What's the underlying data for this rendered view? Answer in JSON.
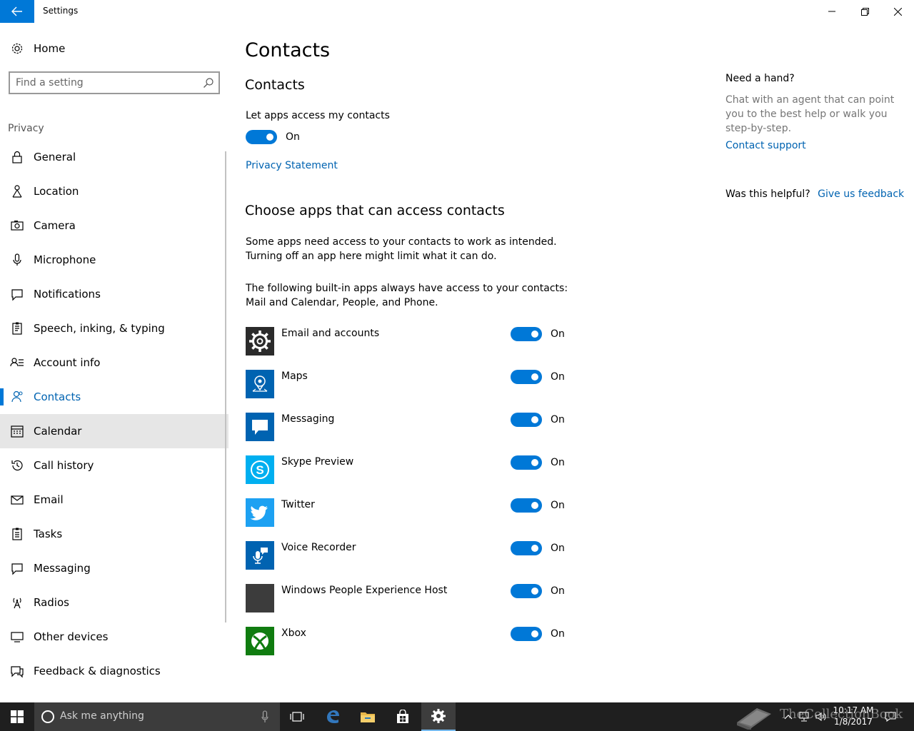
{
  "window": {
    "title": "Settings",
    "back_icon": "arrow-left-icon",
    "minimize_icon": "minimize-icon",
    "maximize_icon": "restore-icon",
    "close_icon": "close-icon"
  },
  "sidebar": {
    "home_label": "Home",
    "search_placeholder": "Find a setting",
    "group_label": "Privacy",
    "items": [
      {
        "label": "General",
        "icon": "lock-icon"
      },
      {
        "label": "Location",
        "icon": "location-icon"
      },
      {
        "label": "Camera",
        "icon": "camera-icon"
      },
      {
        "label": "Microphone",
        "icon": "microphone-icon"
      },
      {
        "label": "Notifications",
        "icon": "notifications-icon"
      },
      {
        "label": "Speech, inking, & typing",
        "icon": "speech-icon"
      },
      {
        "label": "Account info",
        "icon": "account-info-icon"
      },
      {
        "label": "Contacts",
        "icon": "contacts-icon",
        "active": true
      },
      {
        "label": "Calendar",
        "icon": "calendar-icon",
        "hover": true
      },
      {
        "label": "Call history",
        "icon": "history-icon"
      },
      {
        "label": "Email",
        "icon": "email-icon"
      },
      {
        "label": "Tasks",
        "icon": "tasks-icon"
      },
      {
        "label": "Messaging",
        "icon": "messaging-icon"
      },
      {
        "label": "Radios",
        "icon": "radios-icon"
      },
      {
        "label": "Other devices",
        "icon": "other-devices-icon"
      },
      {
        "label": "Feedback & diagnostics",
        "icon": "feedback-icon"
      }
    ]
  },
  "main": {
    "page_title": "Contacts",
    "section1_title": "Contacts",
    "access_label": "Let apps access my contacts",
    "access_state": "On",
    "privacy_link": "Privacy Statement",
    "section2_title": "Choose apps that can access contacts",
    "desc1_line1": "Some apps need access to your contacts to work as intended.",
    "desc1_line2": "Turning off an app here might limit what it can do.",
    "desc2_line1": "The following built-in apps always have access to your contacts:",
    "desc2_line2": "Mail and Calendar, People, and Phone.",
    "apps": [
      {
        "name": "Email and accounts",
        "state": "On",
        "tile_color": "#2b2b2b",
        "icon": "gear-icon"
      },
      {
        "name": "Maps",
        "state": "On",
        "tile_color": "#0063b1",
        "icon": "maps-icon"
      },
      {
        "name": "Messaging",
        "state": "On",
        "tile_color": "#0063b1",
        "icon": "message-bubble-icon"
      },
      {
        "name": "Skype Preview",
        "state": "On",
        "tile_color": "#00aff0",
        "icon": "skype-icon"
      },
      {
        "name": "Twitter",
        "state": "On",
        "tile_color": "#1da1f2",
        "icon": "twitter-bird-icon"
      },
      {
        "name": "Voice Recorder",
        "state": "On",
        "tile_color": "#0063b1",
        "icon": "voice-recorder-icon"
      },
      {
        "name": "Windows People Experience Host",
        "state": "On",
        "tile_color": "#3c3c3c",
        "icon": "blank-tile-icon"
      },
      {
        "name": "Xbox",
        "state": "On",
        "tile_color": "#107c10",
        "icon": "xbox-icon"
      }
    ]
  },
  "help": {
    "title": "Need a hand?",
    "text": "Chat with an agent that can point you to the best help or walk you step-by-step.",
    "link": "Contact support",
    "helpful_question": "Was this helpful?",
    "feedback_link": "Give us feedback"
  },
  "taskbar": {
    "search_text": "Ask me anything",
    "clock_time": "10:17 AM",
    "clock_date": "1/8/2017",
    "watermark": "TheCollectionBook",
    "accent": "#0078d7"
  }
}
